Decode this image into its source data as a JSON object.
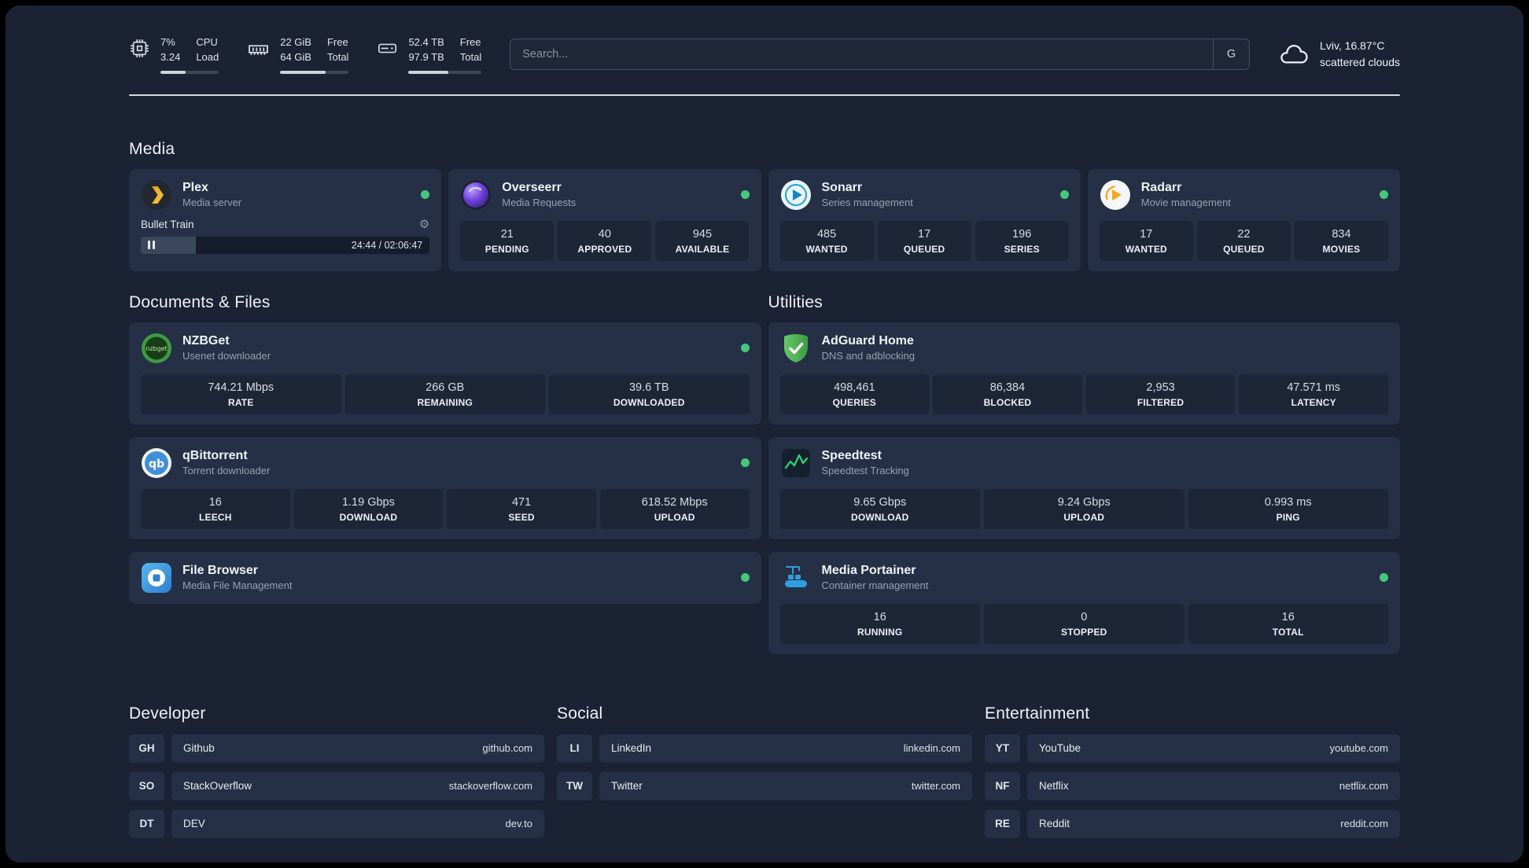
{
  "theme": {
    "status_color": "#46c87c"
  },
  "topbar": {
    "cpu": {
      "percent": "7%",
      "load": "3.24",
      "label_top": "CPU",
      "label_bottom": "Load",
      "bar_percent": 43
    },
    "ram": {
      "free": "22 GiB",
      "total": "64 GiB",
      "label_top": "Free",
      "label_bottom": "Total",
      "bar_percent": 66
    },
    "disk": {
      "free": "52.4 TB",
      "total": "97.9 TB",
      "label_top": "Free",
      "label_bottom": "Total",
      "bar_percent": 54
    },
    "search": {
      "placeholder": "Search...",
      "engine_label": "G"
    },
    "weather": {
      "location": "Lviv, 16.87°C",
      "condition": "scattered clouds"
    }
  },
  "sections": {
    "media": "Media",
    "documents": "Documents & Files",
    "utilities": "Utilities",
    "developer": "Developer",
    "social": "Social",
    "entertainment": "Entertainment"
  },
  "apps": {
    "plex": {
      "name": "Plex",
      "desc": "Media server",
      "now_playing": "Bullet Train",
      "time": "24:44 / 02:06:47",
      "progress_percent": 19
    },
    "overseerr": {
      "name": "Overseerr",
      "desc": "Media Requests",
      "stats": [
        {
          "value": "21",
          "label": "PENDING"
        },
        {
          "value": "40",
          "label": "APPROVED"
        },
        {
          "value": "945",
          "label": "AVAILABLE"
        }
      ]
    },
    "sonarr": {
      "name": "Sonarr",
      "desc": "Series management",
      "stats": [
        {
          "value": "485",
          "label": "WANTED"
        },
        {
          "value": "17",
          "label": "QUEUED"
        },
        {
          "value": "196",
          "label": "SERIES"
        }
      ]
    },
    "radarr": {
      "name": "Radarr",
      "desc": "Movie management",
      "stats": [
        {
          "value": "17",
          "label": "WANTED"
        },
        {
          "value": "22",
          "label": "QUEUED"
        },
        {
          "value": "834",
          "label": "MOVIES"
        }
      ]
    },
    "nzbget": {
      "name": "NZBGet",
      "desc": "Usenet downloader",
      "icon_text": "nzbget",
      "stats": [
        {
          "value": "744.21 Mbps",
          "label": "RATE"
        },
        {
          "value": "266 GB",
          "label": "REMAINING"
        },
        {
          "value": "39.6 TB",
          "label": "DOWNLOADED"
        }
      ]
    },
    "qbittorrent": {
      "name": "qBittorrent",
      "desc": "Torrent downloader",
      "icon_text": "qb",
      "stats": [
        {
          "value": "16",
          "label": "LEECH"
        },
        {
          "value": "1.19 Gbps",
          "label": "DOWNLOAD"
        },
        {
          "value": "471",
          "label": "SEED"
        },
        {
          "value": "618.52 Mbps",
          "label": "UPLOAD"
        }
      ]
    },
    "filebrowser": {
      "name": "File Browser",
      "desc": "Media File Management"
    },
    "adguard": {
      "name": "AdGuard Home",
      "desc": "DNS and adblocking",
      "stats": [
        {
          "value": "498,461",
          "label": "QUERIES"
        },
        {
          "value": "86,384",
          "label": "BLOCKED"
        },
        {
          "value": "2,953",
          "label": "FILTERED"
        },
        {
          "value": "47.571 ms",
          "label": "LATENCY"
        }
      ]
    },
    "speedtest": {
      "name": "Speedtest",
      "desc": "Speedtest Tracking",
      "stats": [
        {
          "value": "9.65 Gbps",
          "label": "DOWNLOAD"
        },
        {
          "value": "9.24 Gbps",
          "label": "UPLOAD"
        },
        {
          "value": "0.993 ms",
          "label": "PING"
        }
      ]
    },
    "portainer": {
      "name": "Media Portainer",
      "desc": "Container management",
      "stats": [
        {
          "value": "16",
          "label": "RUNNING"
        },
        {
          "value": "0",
          "label": "STOPPED"
        },
        {
          "value": "16",
          "label": "TOTAL"
        }
      ]
    }
  },
  "bookmarks": {
    "developer": [
      {
        "abbr": "GH",
        "name": "Github",
        "url": "github.com"
      },
      {
        "abbr": "SO",
        "name": "StackOverflow",
        "url": "stackoverflow.com"
      },
      {
        "abbr": "DT",
        "name": "DEV",
        "url": "dev.to"
      }
    ],
    "social": [
      {
        "abbr": "LI",
        "name": "LinkedIn",
        "url": "linkedin.com"
      },
      {
        "abbr": "TW",
        "name": "Twitter",
        "url": "twitter.com"
      }
    ],
    "entertainment": [
      {
        "abbr": "YT",
        "name": "YouTube",
        "url": "youtube.com"
      },
      {
        "abbr": "NF",
        "name": "Netflix",
        "url": "netflix.com"
      },
      {
        "abbr": "RE",
        "name": "Reddit",
        "url": "reddit.com"
      }
    ]
  }
}
